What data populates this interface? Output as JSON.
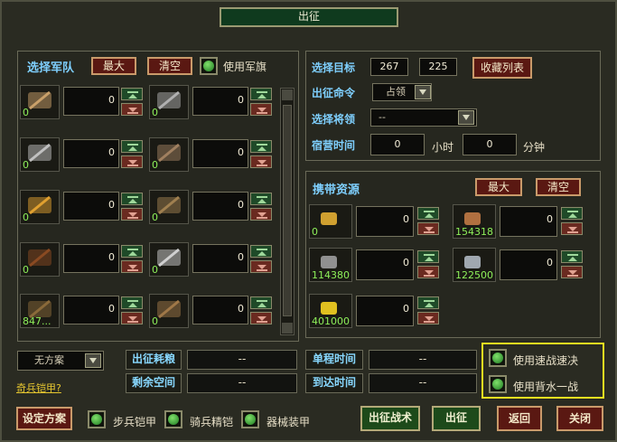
{
  "window": {
    "title": "出征"
  },
  "troops": {
    "title": "选择军队",
    "max_label": "最大",
    "clear_label": "清空",
    "use_flag_label": "使用军旗",
    "units": [
      {
        "icon": "shield-club-icon",
        "count": "0",
        "value": "0"
      },
      {
        "icon": "trident-icon",
        "count": "0",
        "value": "0"
      },
      {
        "icon": "sword-icon",
        "count": "0",
        "value": "0"
      },
      {
        "icon": "spear-icon",
        "count": "0",
        "value": "0"
      },
      {
        "icon": "round-shield-icon",
        "count": "0",
        "value": "0"
      },
      {
        "icon": "bow-icon",
        "count": "0",
        "value": "0"
      },
      {
        "icon": "horse-icon",
        "count": "0",
        "value": "0"
      },
      {
        "icon": "armored-horse-icon",
        "count": "0",
        "value": "0"
      },
      {
        "icon": "supply-cart-icon",
        "count": "847...",
        "value": "0"
      },
      {
        "icon": "crossbow-icon",
        "count": "0",
        "value": "0"
      }
    ]
  },
  "target": {
    "select_target_label": "选择目标",
    "x": "267",
    "y": "225",
    "favorites_label": "收藏列表",
    "command_label": "出征命令",
    "command_value": "占领",
    "general_label": "选择将领",
    "general_value": "--",
    "camp_time_label": "宿营时间",
    "hours": "0",
    "hours_unit": "小时",
    "minutes": "0",
    "minutes_unit": "分钟"
  },
  "resources": {
    "title": "携带资源",
    "max_label": "最大",
    "clear_label": "清空",
    "items": [
      {
        "icon": "grain-icon",
        "amount": "0",
        "value": "0"
      },
      {
        "icon": "wood-icon",
        "amount": "154318",
        "value": "0"
      },
      {
        "icon": "stone-icon",
        "amount": "114380",
        "value": "0"
      },
      {
        "icon": "iron-icon",
        "amount": "122500",
        "value": "0"
      },
      {
        "icon": "gold-icon",
        "amount": "401000",
        "value": "0"
      }
    ]
  },
  "bottom": {
    "plan_value": "无方案",
    "armor_link": "奇兵铠甲?",
    "food_cost_label": "出征耗粮",
    "food_cost_value": "--",
    "remaining_space_label": "剩余空间",
    "remaining_space_value": "--",
    "one_way_label": "单程时间",
    "one_way_value": "--",
    "arrival_label": "到达时间",
    "arrival_value": "--",
    "speed_label": "使用速战速决",
    "last_stand_label": "使用背水一战",
    "set_plan_label": "设定方案",
    "infantry_armor_label": "步兵铠甲",
    "cavalry_armor_label": "骑兵精铠",
    "machine_armor_label": "器械装甲",
    "tactics_label": "出征战术",
    "march_label": "出征",
    "back_label": "返回",
    "close_label": "关闭"
  },
  "colors": {
    "accent_title": "#7fd0ff",
    "count_green": "#8ef05a",
    "highlight": "#f0e020"
  }
}
